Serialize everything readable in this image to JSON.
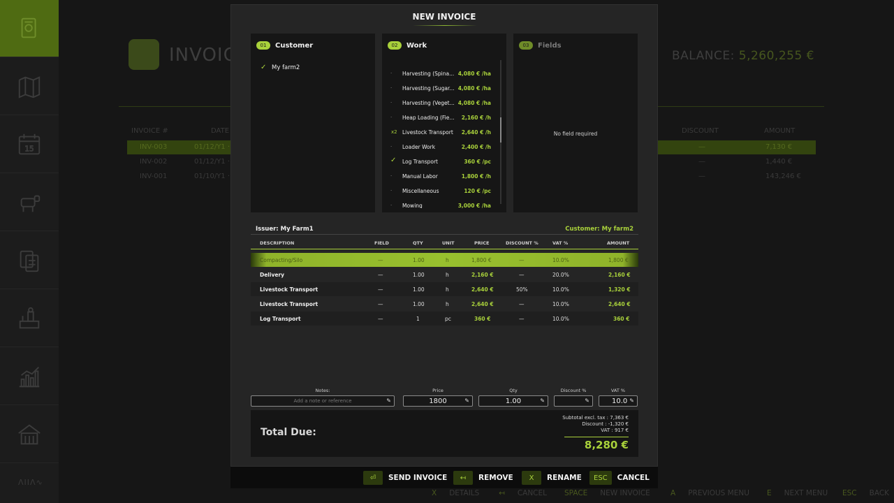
{
  "background": {
    "title": "INVOIC",
    "balance_label": "BALANCE:",
    "balance_value": "5,260,255 €",
    "columns": [
      "INVOICE #",
      "DATE",
      "DISCOUNT",
      "AMOUNT"
    ],
    "rows": [
      {
        "id": "INV-003",
        "date": "01/12/Y1 ·",
        "discount": "—",
        "amount": "7,130 €"
      },
      {
        "id": "INV-002",
        "date": "01/12/Y1 · 2",
        "discount": "—",
        "amount": "1,440 €"
      },
      {
        "id": "INV-001",
        "date": "01/10/Y1 ·",
        "discount": "—",
        "amount": "143,246 €"
      }
    ],
    "footer": [
      {
        "key": "X",
        "label": "DETAILS"
      },
      {
        "key": "↤",
        "label": "CANCEL"
      },
      {
        "key": "SPACE",
        "label": "NEW INVOICE"
      },
      {
        "key": "A",
        "label": "PREVIOUS MENU"
      },
      {
        "key": "E",
        "label": "NEXT MENU"
      },
      {
        "key": "ESC",
        "label": "BACK"
      }
    ],
    "sidebar_bottom": "ΛIIΛ∿"
  },
  "modal": {
    "title": "NEW INVOICE",
    "panels": {
      "customer": {
        "step": "01",
        "title": "Customer",
        "selected": "My farm2"
      },
      "work": {
        "step": "02",
        "title": "Work",
        "items": [
          {
            "mark": "·",
            "name": "Harvesting (Spina...",
            "price": "4,080 € /ha"
          },
          {
            "mark": "·",
            "name": "Harvesting (Sugar...",
            "price": "4,080 € /ha"
          },
          {
            "mark": "·",
            "name": "Harvesting (Veget...",
            "price": "4,080 € /ha"
          },
          {
            "mark": "·",
            "name": "Heap Loading (Fie...",
            "price": "2,160 € /h"
          },
          {
            "mark": "x2",
            "name": "Livestock Transport",
            "price": "2,640 € /h"
          },
          {
            "mark": "·",
            "name": "Loader Work",
            "price": "2,400 € /h"
          },
          {
            "mark": "✓",
            "name": "Log Transport",
            "price": "360 € /pc"
          },
          {
            "mark": "·",
            "name": "Manual Labor",
            "price": "1,800 € /h"
          },
          {
            "mark": "·",
            "name": "Miscellaneous",
            "price": "120 € /pc"
          },
          {
            "mark": "·",
            "name": "Mowing",
            "price": "3,000 € /ha"
          }
        ]
      },
      "fields": {
        "step": "03",
        "title": "Fields",
        "message": "No field required"
      }
    },
    "issuer": "Issuer: My Farm1",
    "customer": "Customer: My farm2",
    "table": {
      "headers": [
        "DESCRIPTION",
        "FIELD",
        "QTY",
        "UNIT",
        "PRICE",
        "DISCOUNT %",
        "VAT %",
        "AMOUNT"
      ],
      "rows": [
        {
          "desc": "Compacting/Silo",
          "field": "—",
          "qty": "1.00",
          "unit": "h",
          "price": "1,800 €",
          "disc": "—",
          "vat": "10.0%",
          "amount": "1,800 €"
        },
        {
          "desc": "Delivery",
          "field": "—",
          "qty": "1.00",
          "unit": "h",
          "price": "2,160 €",
          "disc": "—",
          "vat": "20.0%",
          "amount": "2,160 €"
        },
        {
          "desc": "Livestock Transport",
          "field": "—",
          "qty": "1.00",
          "unit": "h",
          "price": "2,640 €",
          "disc": "50%",
          "vat": "10.0%",
          "amount": "1,320 €"
        },
        {
          "desc": "Livestock Transport",
          "field": "—",
          "qty": "1.00",
          "unit": "h",
          "price": "2,640 €",
          "disc": "—",
          "vat": "10.0%",
          "amount": "2,640 €"
        },
        {
          "desc": "Log Transport",
          "field": "—",
          "qty": "1",
          "unit": "pc",
          "price": "360 €",
          "disc": "—",
          "vat": "10.0%",
          "amount": "360 €"
        }
      ]
    },
    "edit": {
      "notes_label": "Notes:",
      "notes_placeholder": "Add a note or reference",
      "price_label": "Price",
      "price_value": "1800",
      "qty_label": "Qty",
      "qty_value": "1.00",
      "discount_label": "Discount %",
      "discount_value": "",
      "vat_label": "VAT %",
      "vat_value": "10.0"
    },
    "totals": {
      "label": "Total Due:",
      "subtotal": "Subtotal excl. tax : 7,363 €",
      "discount": "Discount : -1,320 €",
      "vat": "VAT : 917 €",
      "grand": "8,280 €"
    },
    "actions": [
      {
        "key": "⏎",
        "label": "SEND INVOICE"
      },
      {
        "key": "↤",
        "label": "REMOVE"
      },
      {
        "key": "X",
        "label": "RENAME"
      },
      {
        "key": "ESC",
        "label": "CANCEL"
      }
    ]
  },
  "colors": {
    "accent": "#a9d13b",
    "panel": "#161616",
    "modal": "#252525"
  }
}
